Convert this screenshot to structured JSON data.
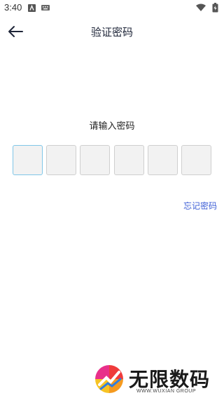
{
  "status_bar": {
    "time": "3:40"
  },
  "header": {
    "title": "验证密码"
  },
  "prompt": "请输入密码",
  "pin": {
    "length": 6,
    "active_index": 0
  },
  "forgot_password": "忘记密码",
  "watermark": {
    "brand": "无限数码",
    "sub": "WWW.WUXIAN GROUP"
  },
  "colors": {
    "accent": "#3e5fd6",
    "active_border": "#7fc6e8",
    "title": "#1e2538"
  }
}
